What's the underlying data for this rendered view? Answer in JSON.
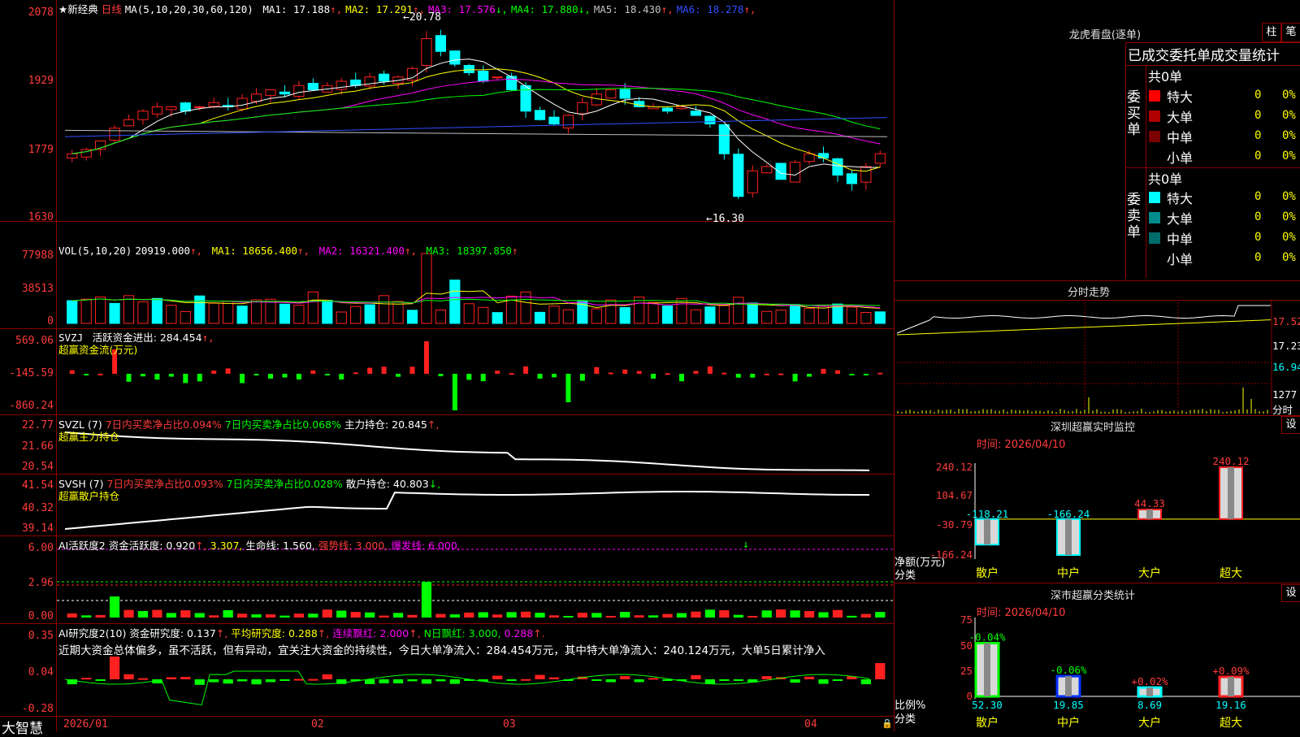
{
  "main": {
    "title": "★新经典",
    "period": "日线",
    "ma_header": "MA(5,10,20,30,60,120)",
    "ma": [
      {
        "label": "MA1: 17.188",
        "arrow": "↑",
        "color": "#ffffff"
      },
      {
        "label": "MA2: 17.291",
        "arrow": "↑",
        "color": "#ffff00"
      },
      {
        "label": "MA3: 17.576",
        "arrow": "↓",
        "color": "#ff00ff"
      },
      {
        "label": "MA4: 17.880",
        "arrow": "↓",
        "color": "#00ff00"
      },
      {
        "label": "MA5: 18.430",
        "arrow": "↑",
        "color": "#c0c0c0"
      },
      {
        "label": "MA6: 18.278",
        "arrow": "↑",
        "color": "#3050ff"
      }
    ],
    "y_ticks": [
      "2078",
      "1929",
      "1779",
      "1630"
    ],
    "high_label": "20.78",
    "low_label": "16.30",
    "colors": {
      "up": "#ff2020",
      "down": "#00ffff"
    }
  },
  "vol": {
    "header": "VOL(5,10,20)",
    "value": "20919.000",
    "ma": [
      {
        "label": "MA1: 18656.400",
        "color": "#ffff00"
      },
      {
        "label": "MA2: 16321.400",
        "color": "#ff00ff"
      },
      {
        "label": "MA3: 18397.850",
        "color": "#00ff00"
      }
    ],
    "y_ticks": [
      "77988",
      "38513",
      "0"
    ]
  },
  "svzj": {
    "header": "SVZJ",
    "label": "活跃资金进出: 284.454",
    "sub": "超赢资金流(万元)",
    "y_ticks": [
      "569.06",
      "-145.59",
      "-860.24"
    ]
  },
  "svzl": {
    "header": "SVZL (7)",
    "a": "7日内买卖净占比0.094%",
    "b": "7日内买卖净占比0.068%",
    "c": "主力持仓: 20.845",
    "sub": "超赢主力持仓",
    "y_ticks": [
      "22.77",
      "21.66",
      "20.54"
    ]
  },
  "svsh": {
    "header": "SVSH (7)",
    "a": "7日内买卖净占比0.093%",
    "b": "7日内买卖净占比0.028%",
    "c": "散户持仓: 40.803",
    "sub": "超赢散户持仓",
    "y_ticks": [
      "41.54",
      "40.32",
      "39.14"
    ]
  },
  "ai1": {
    "header": "AI活跃度2",
    "a": "资金活跃度: 0.920",
    "b": "3.307,",
    "c": "生命线: 1.560,",
    "d": "强势线: 3.000,",
    "e": "爆发线: 6.000,",
    "y_ticks": [
      "6.00",
      "2.96",
      "0.00"
    ]
  },
  "ai2": {
    "header": "AI研究度2(10)",
    "a": "资金研究度: 0.137",
    "b": "平均研究度: 0.288",
    "c": "连续飘红: 2.000",
    "d": "N日飘红: 3.000,",
    "e": "0.288",
    "comment": "近期大资金总体偏多，虽不活跃，但有异动，宜关注大资金的持续性，今日大单净流入：284.454万元，其中特大单净流入：240.124万元，大单5日累计净入",
    "y_ticks": [
      "0.35",
      "0.04",
      "-0.28"
    ]
  },
  "xaxis": {
    "brand": "大智慧",
    "labels": [
      "2026/01",
      "02",
      "03",
      "04"
    ]
  },
  "right": {
    "lhb_title": "龙虎看盘(逐单)",
    "btn1": "柱",
    "btn2": "笔",
    "table_title": "已成交委托单成交量统计",
    "buy": {
      "side": "委买单",
      "total": "共0单",
      "rows": [
        {
          "name": "特大",
          "v": "0",
          "p": "0%",
          "color": "#ff0000"
        },
        {
          "name": "大单",
          "v": "0",
          "p": "0%",
          "color": "#b00000"
        },
        {
          "name": "中单",
          "v": "0",
          "p": "0%",
          "color": "#7a0000"
        },
        {
          "name": "小单",
          "v": "0",
          "p": "0%",
          "color": "#000000"
        }
      ]
    },
    "sell": {
      "side": "委卖单",
      "total": "共0单",
      "rows": [
        {
          "name": "特大",
          "v": "0",
          "p": "0%",
          "color": "#00ffff"
        },
        {
          "name": "大单",
          "v": "0",
          "p": "0%",
          "color": "#008b8b"
        },
        {
          "name": "中单",
          "v": "0",
          "p": "0%",
          "color": "#006b6b"
        },
        {
          "name": "小单",
          "v": "0",
          "p": "0%",
          "color": "#000000"
        }
      ]
    },
    "fenshi": {
      "title": "分时走势",
      "y_ticks": [
        "17.52",
        "17.23",
        "16.94",
        "1277",
        "分时"
      ]
    },
    "monitor": {
      "title": "深圳超赢实时监控",
      "btn": "设",
      "time": "时间: 2026/04/10",
      "y_ticks": [
        "240.12",
        "104.67",
        "-30.79",
        "-166.24"
      ],
      "ylabel1": "净额(万元)",
      "ylabel2": "分类",
      "bars": [
        {
          "cat": "散户",
          "value": -118.21,
          "label": "-118.21"
        },
        {
          "cat": "中户",
          "value": -166.24,
          "label": "-166.24"
        },
        {
          "cat": "大户",
          "value": 44.33,
          "label": "44.33"
        },
        {
          "cat": "超大",
          "value": 240.12,
          "label": "240.12"
        }
      ]
    },
    "stats": {
      "title": "深市超赢分类统计",
      "btn": "设",
      "time": "时间: 2026/04/10",
      "y_ticks": [
        "75",
        "50",
        "25",
        "0"
      ],
      "ylabel1": "比例%",
      "ylabel2": "分类",
      "bars": [
        {
          "cat": "散户",
          "value": 52.3,
          "label": "52.30",
          "delta": "-0.04%"
        },
        {
          "cat": "中户",
          "value": 19.85,
          "label": "19.85",
          "delta": "-0.06%"
        },
        {
          "cat": "大户",
          "value": 8.69,
          "label": "8.69",
          "delta": "+0.02%"
        },
        {
          "cat": "超大",
          "value": 19.16,
          "label": "19.16",
          "delta": "+0.09%"
        }
      ]
    }
  }
}
